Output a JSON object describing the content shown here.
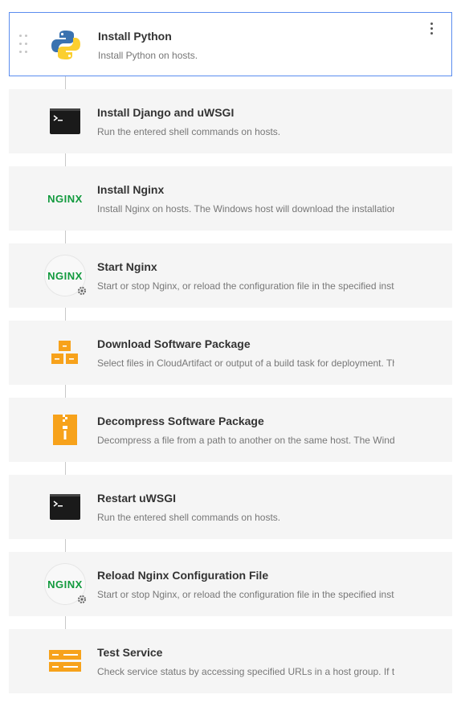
{
  "steps": [
    {
      "title": "Install Python",
      "desc": "Install Python on hosts.",
      "icon": "python-icon",
      "selected": true
    },
    {
      "title": "Install Django and uWSGI",
      "desc": "Run the entered shell commands on hosts.",
      "icon": "terminal-icon"
    },
    {
      "title": "Install Nginx",
      "desc": "Install Nginx on hosts. The Windows host will download the installation",
      "icon": "nginx-icon",
      "icon_text": "NGINX"
    },
    {
      "title": "Start Nginx",
      "desc": "Start or stop Nginx, or reload the configuration file in the specified inst",
      "icon": "nginx-gear-icon",
      "icon_text": "NGINX"
    },
    {
      "title": "Download Software Package",
      "desc": "Select files in CloudArtifact or output of a build task for deployment. Th",
      "icon": "package-icon"
    },
    {
      "title": "Decompress Software Package",
      "desc": "Decompress a file from a path to another on the same host. The Wind",
      "icon": "zip-icon"
    },
    {
      "title": "Restart uWSGI",
      "desc": "Run the entered shell commands on hosts.",
      "icon": "terminal-icon"
    },
    {
      "title": "Reload Nginx Configuration File",
      "desc": "Start or stop Nginx, or reload the configuration file in the specified inst",
      "icon": "nginx-gear-icon",
      "icon_text": "NGINX"
    },
    {
      "title": "Test Service",
      "desc": "Check service status by accessing specified URLs in a host group. If t",
      "icon": "service-icon"
    }
  ],
  "colors": {
    "accent_border": "#5b8def",
    "card_bg": "#f5f5f5",
    "nginx_green": "#129a3e",
    "orange": "#f7a21b"
  }
}
